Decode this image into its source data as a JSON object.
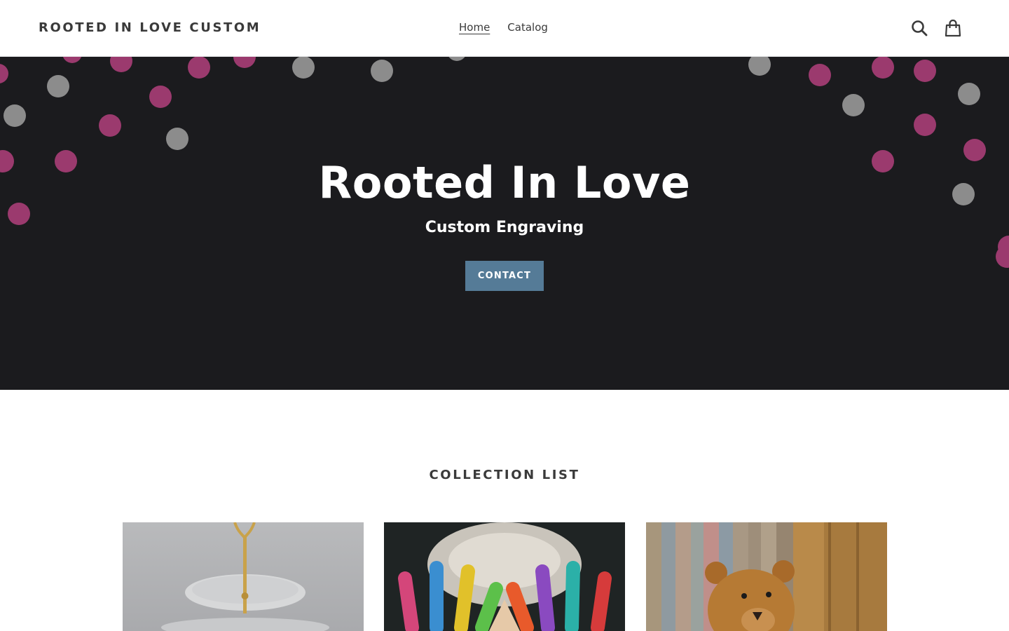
{
  "header": {
    "logo": "ROOTED IN LOVE CUSTOM",
    "nav": [
      {
        "label": "Home"
      },
      {
        "label": "Catalog"
      }
    ],
    "icons": [
      "search-icon",
      "cart-icon"
    ]
  },
  "hero": {
    "title": "Rooted In Love",
    "subtitle": "Custom Engraving",
    "button_label": "CONTACT",
    "colors": {
      "background": "#1b1b1e",
      "button": "#557b97",
      "dot_pink": "#9b3a6e",
      "dot_gray": "#8c8c8c"
    }
  },
  "collections": {
    "title": "COLLECTION LIST",
    "items": [
      {
        "image": "cake-stand-image"
      },
      {
        "image": "painted-hands-image"
      },
      {
        "image": "teddy-bear-image"
      }
    ]
  }
}
